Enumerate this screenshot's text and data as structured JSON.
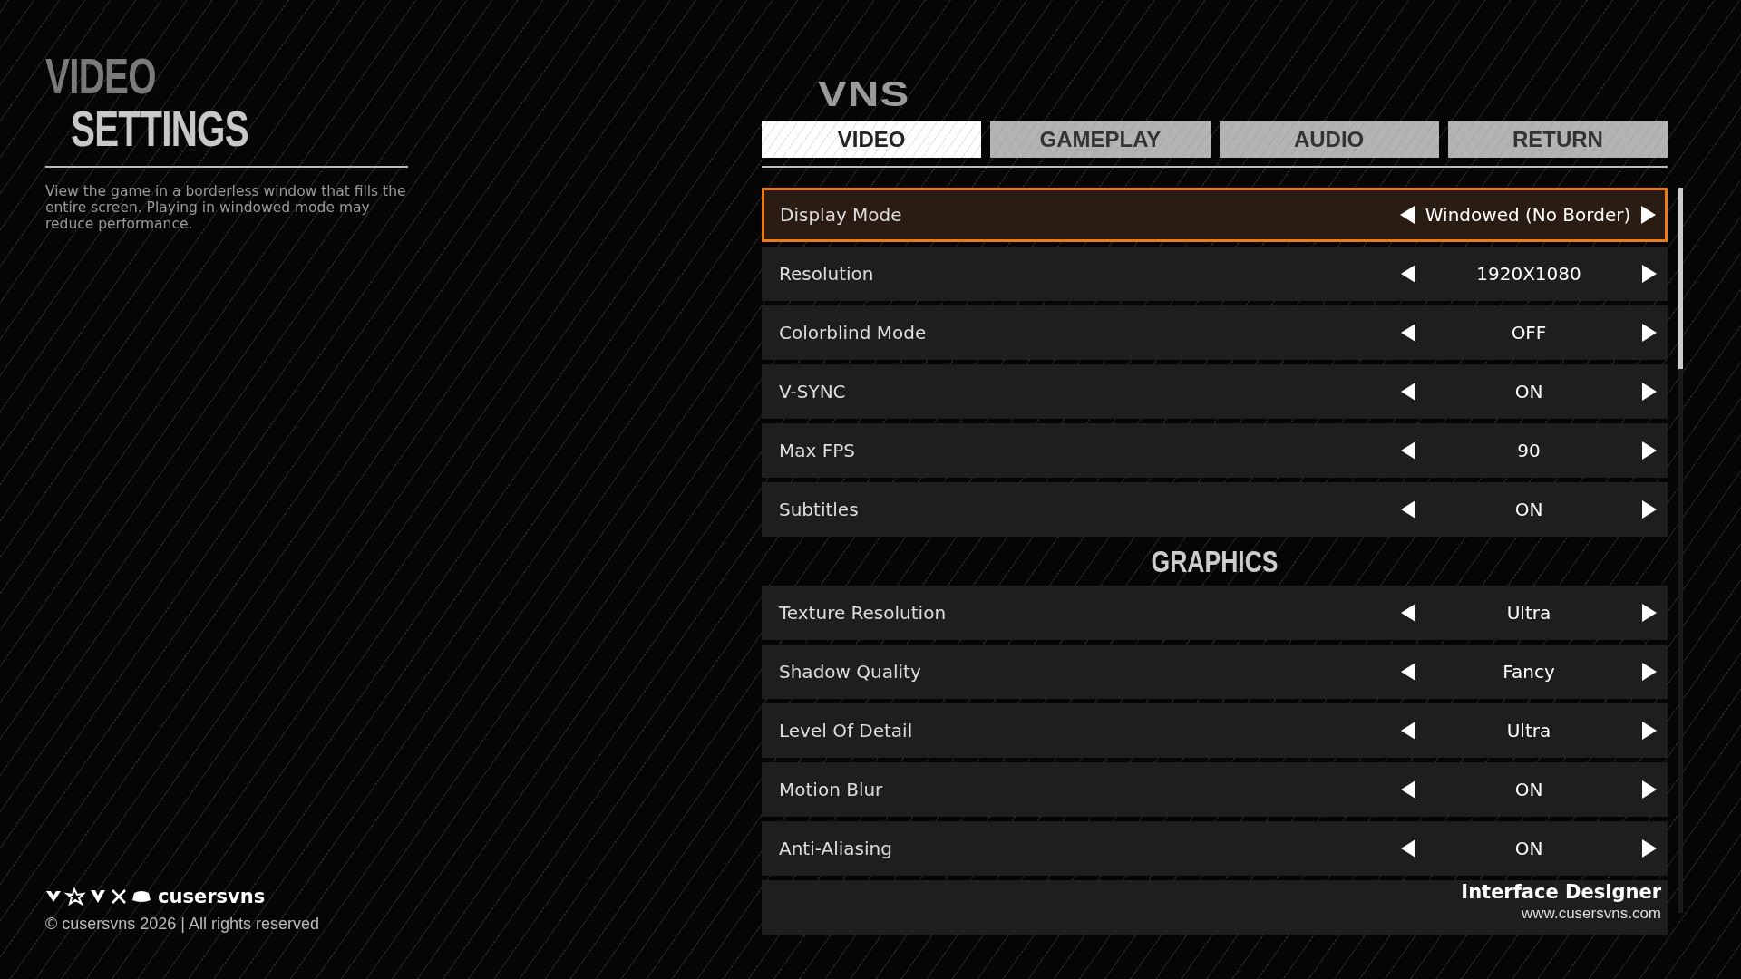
{
  "header": {
    "title_line_1": "VIDEO",
    "title_line_2": "SETTINGS",
    "description": "View the game in a borderless window that fills the entire screen. Playing in windowed mode may reduce performance."
  },
  "logo": "VNS",
  "tabs": [
    {
      "label": "VIDEO",
      "selected": true
    },
    {
      "label": "GAMEPLAY",
      "selected": false
    },
    {
      "label": "AUDIO",
      "selected": false
    },
    {
      "label": "RETURN",
      "selected": false
    }
  ],
  "settings": [
    {
      "label": "Display Mode",
      "value": "Windowed (No Border)",
      "selected": true
    },
    {
      "label": "Resolution",
      "value": "1920X1080",
      "selected": false
    },
    {
      "label": "Colorblind Mode",
      "value": "OFF",
      "selected": false
    },
    {
      "label": "V-SYNC",
      "value": "ON",
      "selected": false
    },
    {
      "label": "Max FPS",
      "value": "90",
      "selected": false
    },
    {
      "label": "Subtitles",
      "value": "ON",
      "selected": false
    }
  ],
  "graphics": {
    "heading": "GRAPHICS",
    "settings": [
      {
        "label": "Texture Resolution",
        "value": "Ultra",
        "selected": false
      },
      {
        "label": "Shadow Quality",
        "value": "Fancy",
        "selected": false
      },
      {
        "label": "Level Of Detail",
        "value": "Ultra",
        "selected": false
      },
      {
        "label": "Motion Blur",
        "value": "ON",
        "selected": false
      },
      {
        "label": "Anti-Aliasing",
        "value": "ON",
        "selected": false
      }
    ]
  },
  "footer": {
    "handle": "cusersvns",
    "copyright": "© cusersvns 2026 | All rights reserved"
  },
  "credit": {
    "role": "Interface Designer",
    "website": "www.cusersvns.com"
  }
}
